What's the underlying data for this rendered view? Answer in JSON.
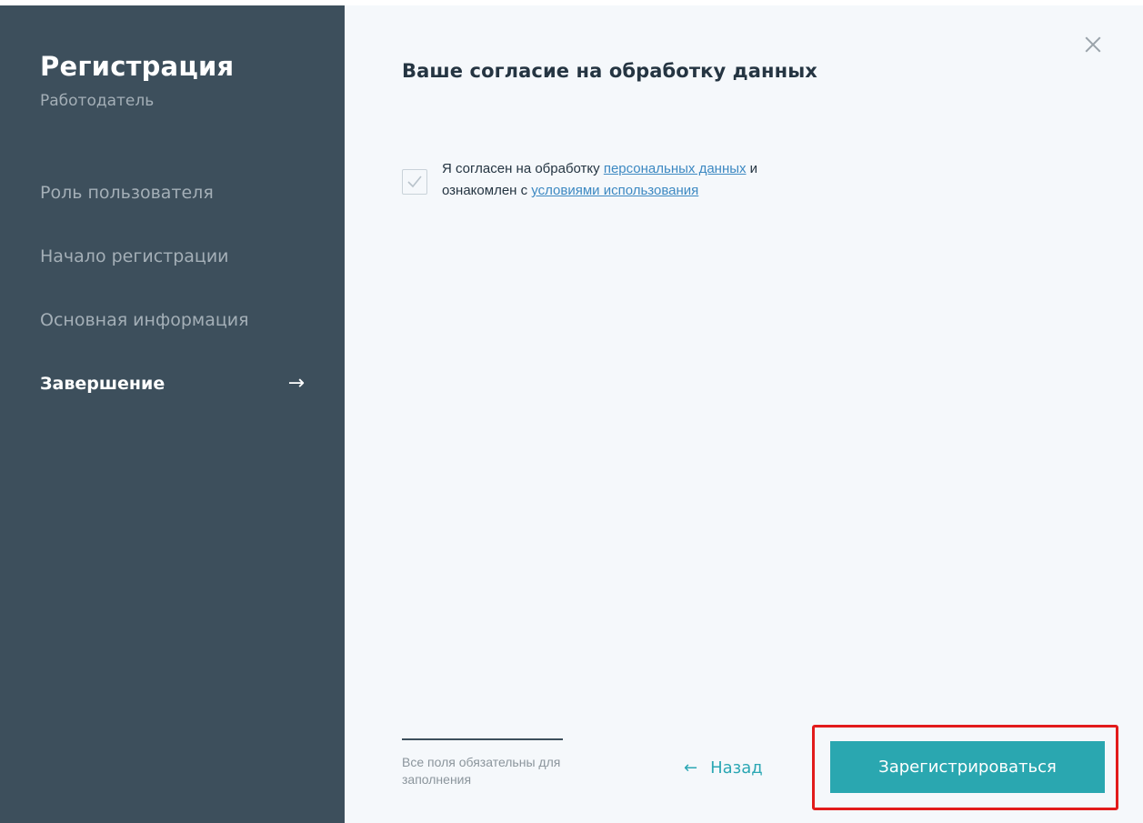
{
  "sidebar": {
    "title": "Регистрация",
    "subtitle": "Работодатель",
    "steps": [
      {
        "label": "Роль пользователя",
        "active": false
      },
      {
        "label": "Начало регистрации",
        "active": false
      },
      {
        "label": "Основная информация",
        "active": false
      },
      {
        "label": "Завершение",
        "active": true,
        "arrow": "→"
      }
    ]
  },
  "main": {
    "close_icon": "close-icon",
    "title": "Ваше согласие на обработку данных",
    "consent": {
      "checked": true,
      "text_before_link1": "Я согласен на обработку ",
      "link1": "персональных данных",
      "text_between": " и",
      "text_line2": "ознакомлен с ",
      "link2": "условиями использования"
    },
    "footer": {
      "required_note": "Все поля обязательны для заполнения",
      "back_arrow": "←",
      "back_label": "Назад",
      "register_label": "Зарегистрироваться"
    }
  },
  "colors": {
    "sidebar_bg": "#3d4f5c",
    "main_bg": "#f5f8fb",
    "accent": "#2aa7b0",
    "link": "#3d89c2",
    "highlight": "#e21b1b"
  }
}
